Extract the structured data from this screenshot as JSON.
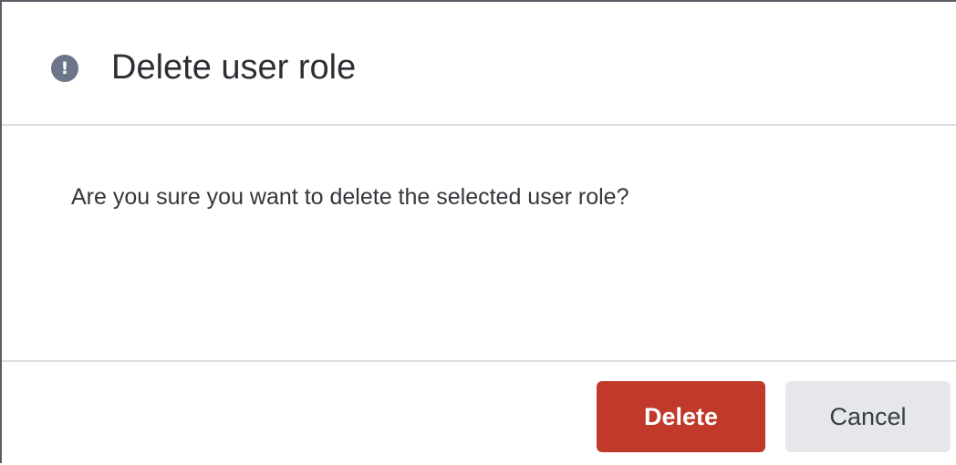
{
  "dialog": {
    "icon": "exclamation-circle-icon",
    "icon_glyph": "!",
    "title": "Delete user role",
    "message": "Are you sure you want to delete the selected user role?",
    "buttons": {
      "delete_label": "Delete",
      "cancel_label": "Cancel"
    }
  },
  "colors": {
    "danger": "#c0392b",
    "secondary": "#e5e7ea",
    "icon": "#6d7689"
  }
}
